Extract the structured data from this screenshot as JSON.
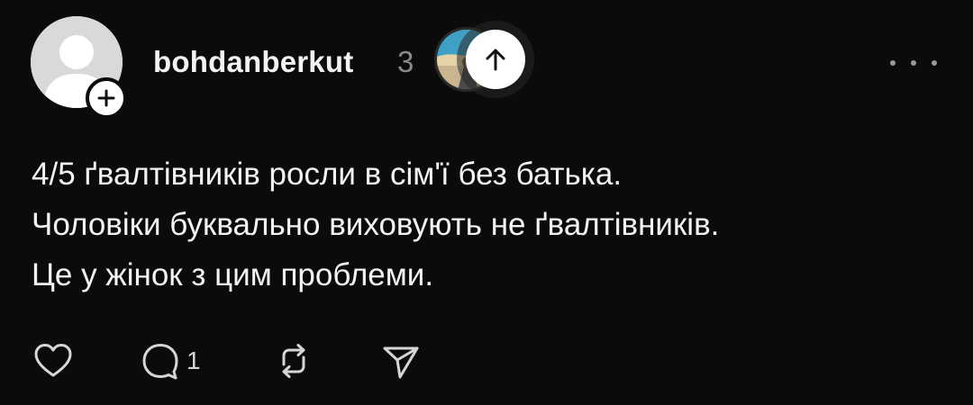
{
  "post": {
    "author": {
      "username": "bohdanberkut",
      "follow_badge": "plus-icon"
    },
    "timestamp": "3",
    "content": {
      "lines": [
        "4/5 ґвалтівників росли в сім'ї без батька.",
        "Чоловіки буквально виховують не ґвалтівників.",
        "Це у жінок з цим проблеми."
      ]
    },
    "actions": {
      "like_icon": "heart-icon",
      "reply_icon": "comment-icon",
      "reply_count": "1",
      "repost_icon": "repost-icon",
      "share_icon": "send-icon"
    },
    "more_icon": "more-dots-icon"
  },
  "overlay": {
    "scroll_top_icon": "arrow-up-icon"
  },
  "colors": {
    "background": "#0b0b0b",
    "text_primary": "#f3f3f3",
    "text_muted": "#8a8a8a",
    "icon": "#d6d6d6"
  }
}
